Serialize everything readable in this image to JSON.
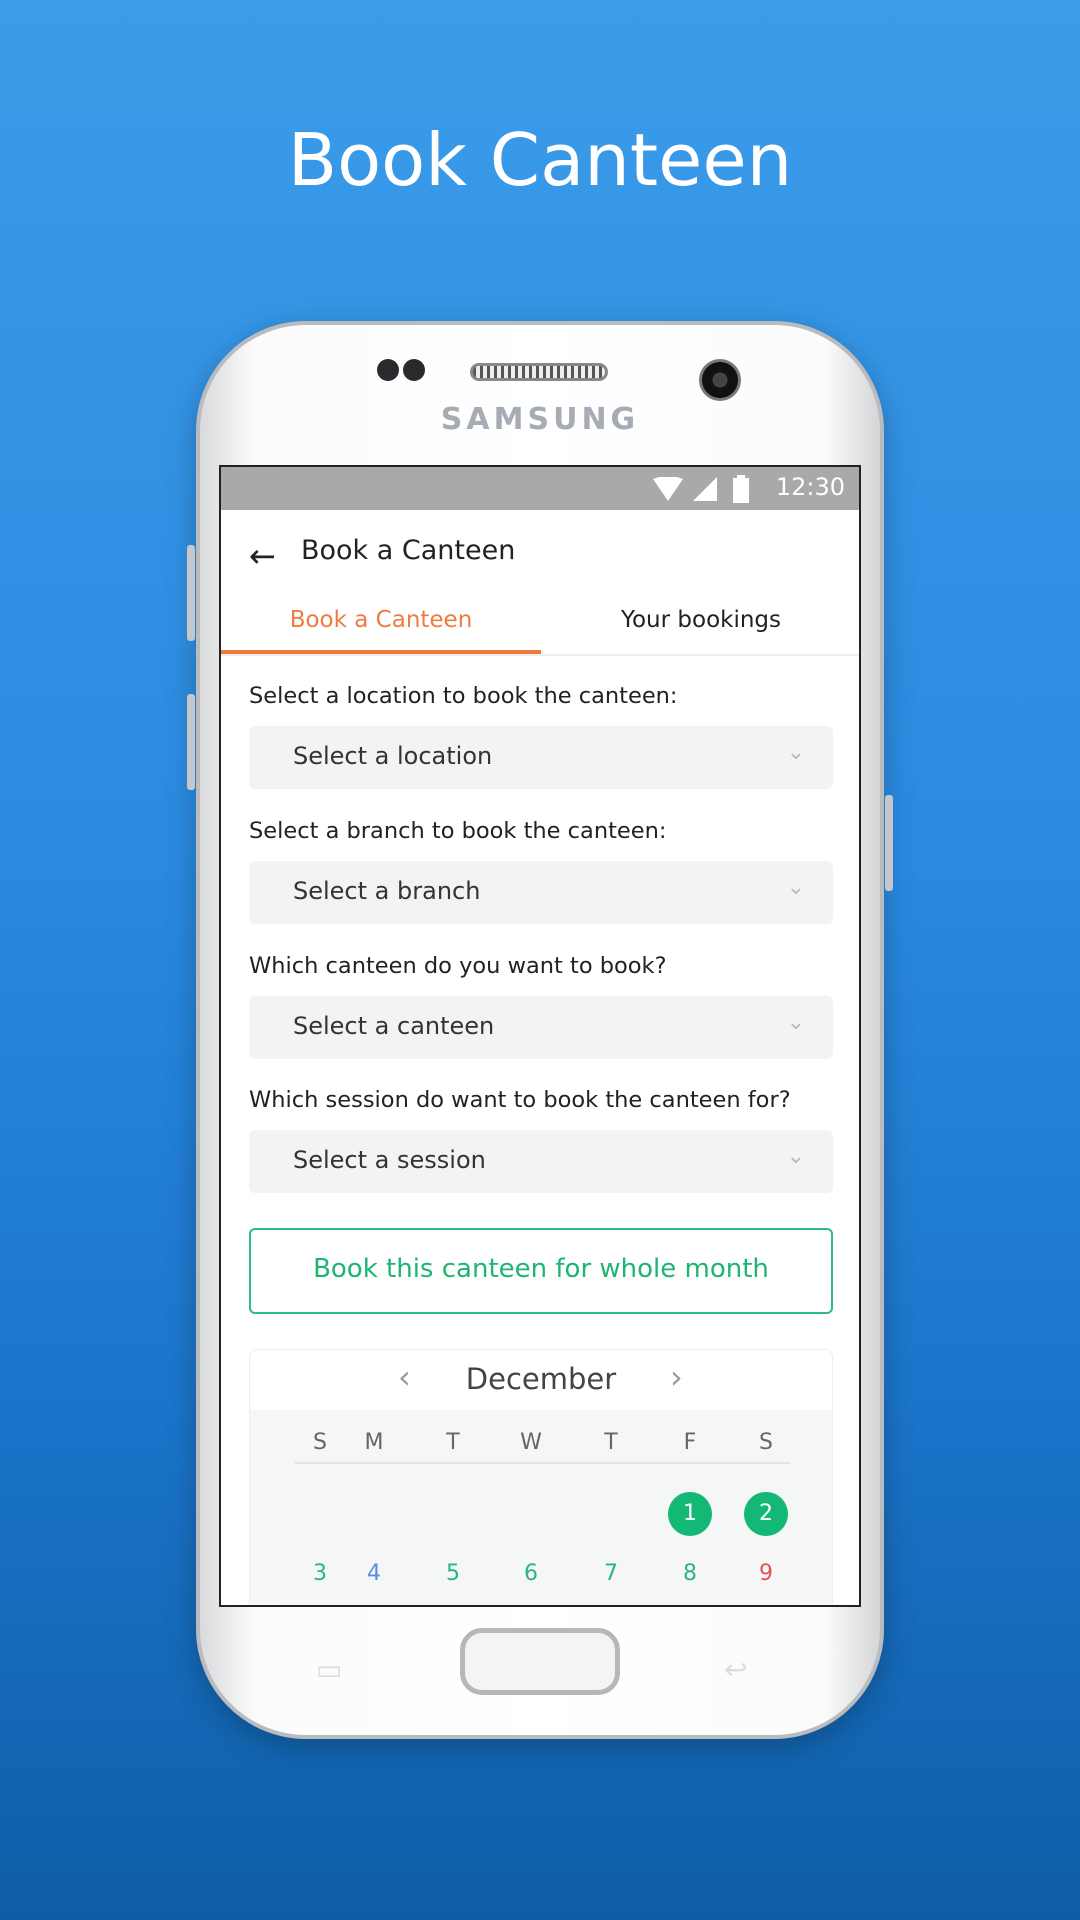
{
  "promo_title": "Book Canteen",
  "device_brand": "SAMSUNG",
  "status_bar": {
    "time": "12:30",
    "icons": [
      "wifi-icon",
      "signal-icon",
      "battery-icon"
    ]
  },
  "app_bar": {
    "title": "Book a Canteen",
    "back_icon": "arrow-left-icon"
  },
  "tabs": [
    {
      "label": "Book a Canteen",
      "active": true
    },
    {
      "label": "Your bookings",
      "active": false
    }
  ],
  "form": {
    "fields": [
      {
        "label": "Select a location to book the canteen:",
        "placeholder": "Select a location"
      },
      {
        "label": "Select a branch to book the canteen:",
        "placeholder": "Select a branch"
      },
      {
        "label": "Which canteen do you want to book?",
        "placeholder": "Select a canteen"
      },
      {
        "label": "Which session do want to book the canteen for?",
        "placeholder": "Select a session"
      }
    ],
    "month_button": "Book this canteen for whole month"
  },
  "calendar": {
    "month": "December",
    "weekdays": [
      "S",
      "M",
      "T",
      "W",
      "T",
      "F",
      "S"
    ],
    "row1": [
      {
        "d": "1",
        "selected": true
      },
      {
        "d": "2",
        "selected": true
      }
    ],
    "row2": [
      {
        "d": "3",
        "color": "#2bb57f"
      },
      {
        "d": "4",
        "color": "#5b8ee6"
      },
      {
        "d": "5",
        "color": "#2bb57f"
      },
      {
        "d": "6",
        "color": "#2bb57f"
      },
      {
        "d": "7",
        "color": "#2bb57f"
      },
      {
        "d": "8",
        "color": "#2bb57f"
      },
      {
        "d": "9",
        "color": "#e05656"
      }
    ]
  },
  "colors": {
    "accent": "#f07b3f",
    "green": "#12b873"
  }
}
